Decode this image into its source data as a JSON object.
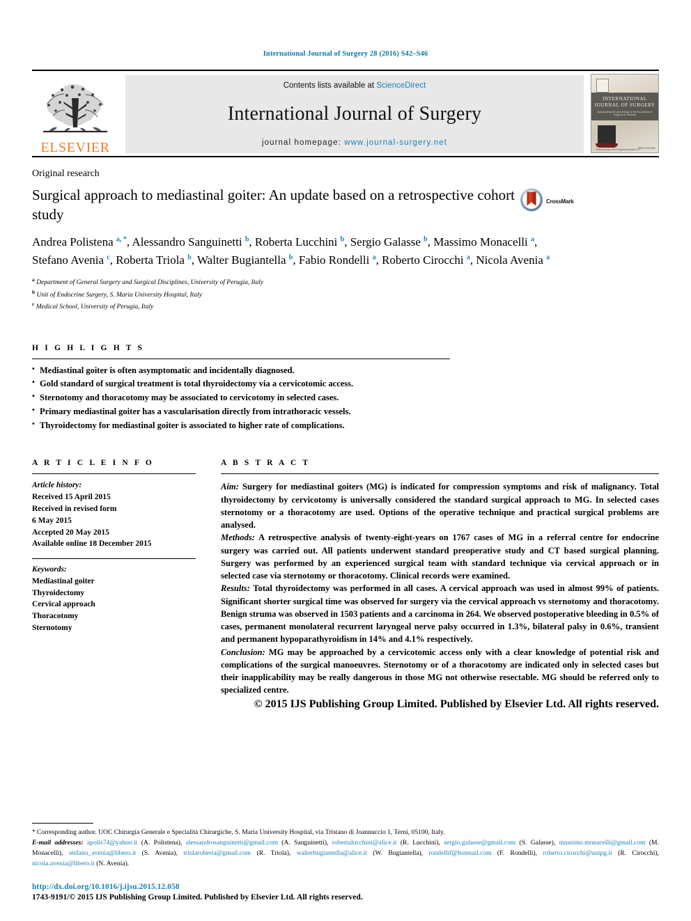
{
  "running_head": "International Journal of Surgery 28 (2016) S42–S46",
  "masthead": {
    "publisher": "ELSEVIER",
    "contents_prefix": "Contents lists available at ",
    "contents_link": "ScienceDirect",
    "journal_name": "International Journal of Surgery",
    "homepage_prefix": "journal homepage: ",
    "homepage_url": "www.journal-surgery.net",
    "cover": {
      "title_line1": "INTERNATIONAL",
      "title_line2": "JOURNAL OF SURGERY",
      "subtitle": "Incorporating the proceedings of the\nAssociation of Surgeons in Training",
      "foot_right": "ISSN 1743-9191",
      "foot_left": "Official journal of the Surgical Associates Ltd"
    }
  },
  "article": {
    "type": "Original research",
    "title": "Surgical approach to mediastinal goiter: An update based on a retrospective cohort study",
    "crossmark_label": "CrossMark",
    "authors": [
      {
        "name": "Andrea Polistena",
        "markers": "a, *",
        "sep": ", "
      },
      {
        "name": "Alessandro Sanguinetti",
        "markers": "b",
        "sep": ", "
      },
      {
        "name": "Roberta Lucchini",
        "markers": "b",
        "sep": ", "
      },
      {
        "name": "Sergio Galasse",
        "markers": "b",
        "sep": ", "
      },
      {
        "name": "Massimo Monacelli",
        "markers": "a",
        "sep": ", "
      },
      {
        "name": "Stefano Avenia",
        "markers": "c",
        "sep": ", "
      },
      {
        "name": "Roberta Triola",
        "markers": "b",
        "sep": ", "
      },
      {
        "name": "Walter Bugiantella",
        "markers": "b",
        "sep": ", "
      },
      {
        "name": "Fabio Rondelli",
        "markers": "a",
        "sep": ", "
      },
      {
        "name": "Roberto Cirocchi",
        "markers": "a",
        "sep": ", "
      },
      {
        "name": "Nicola Avenia",
        "markers": "a",
        "sep": ""
      }
    ],
    "affiliations": [
      {
        "marker": "a",
        "text": "Department of General Surgery and Surgical Disciplines, University of Perugia, Italy"
      },
      {
        "marker": "b",
        "text": "Unit of Endocrine Surgery, S. Maria University Hospital, Italy"
      },
      {
        "marker": "c",
        "text": "Medical School, University of Perugia, Italy"
      }
    ]
  },
  "highlights": {
    "heading": "H I G H L I G H T S",
    "items": [
      "Mediastinal goiter is often asymptomatic and incidentally diagnosed.",
      "Gold standard of surgical treatment is total thyroidectomy via a cervicotomic access.",
      "Sternotomy and thoracotomy may be associated to cervicotomy in selected cases.",
      "Primary mediastinal goiter has a vascularisation directly from intrathoracic vessels.",
      "Thyroidectomy for mediastinal goiter is associated to higher rate of complications."
    ]
  },
  "article_info": {
    "heading": "A R T I C L E   I N F O",
    "history_label": "Article history:",
    "history": [
      "Received 15 April 2015",
      "Received in revised form",
      "6 May 2015",
      "Accepted 20 May 2015",
      "Available online 18 December 2015"
    ],
    "keywords_label": "Keywords:",
    "keywords": [
      "Mediastinal goiter",
      "Thyroidectomy",
      "Cervical approach",
      "Thoracotomy",
      "Sternotomy"
    ]
  },
  "abstract": {
    "heading": "A B S T R A C T",
    "sections": [
      {
        "label": "Aim:",
        "text": " Surgery for mediastinal goiters (MG) is indicated for compression symptoms and risk of malignancy. Total thyroidectomy by cervicotomy is universally considered the standard surgical approach to MG. In selected cases sternotomy or a thoracotomy are used. Options of the operative technique and practical surgical problems are analysed."
      },
      {
        "label": "Methods:",
        "text": " A retrospective analysis of twenty-eight-years on 1767 cases of MG in a referral centre for endocrine surgery was carried out. All patients underwent standard preoperative study and CT based surgical planning. Surgery was performed by an experienced surgical team with standard technique via cervical approach or in selected case via sternotomy or thoracotomy. Clinical records were examined."
      },
      {
        "label": "Results:",
        "text": " Total thyroidectomy was performed in all cases. A cervical approach was used in almost 99% of patients. Significant shorter surgical time was observed for surgery via the cervical approach vs sternotomy and thoracotomy. Benign struma was observed in 1503 patients and a carcinoma in 264. We observed postoperative bleeding in 0.5% of cases, permanent monolateral recurrent laryngeal nerve palsy occurred in 1.3%, bilateral palsy in 0.6%, transient and permanent hypoparathyroidism in 14% and 4.1% respectively."
      },
      {
        "label": "Conclusion:",
        "text": " MG may be approached by a cervicotomic access only with a clear knowledge of potential risk and complications of the surgical manoeuvres. Sternotomy or of a thoracotomy are indicated only in selected cases but their inapplicability may be really dangerous in those MG not otherwise resectable. MG should be referred only to specialized centre."
      }
    ],
    "copyright": "© 2015 IJS Publishing Group Limited. Published by Elsevier Ltd. All rights reserved."
  },
  "footnotes": {
    "corresponding": "Corresponding author. UOC Chirurgia Generale e Specialità Chirurgiche, S. Maria University Hospital, via Tristano di Joannuccio 1, Terni, 05100, Italy.",
    "emails_label": "E-mail addresses:",
    "emails": [
      {
        "email": "apolis74@yahoo.it",
        "who": " (A. Polistena), "
      },
      {
        "email": "alessandrosanguinetti@gmail.com",
        "who": " (A. Sanguinetti), "
      },
      {
        "email": "robertalucchini@alice.it",
        "who": " (R. Lucchini), "
      },
      {
        "email": "sergio.galasse@gmail.com",
        "who": " (S. Galasse), "
      },
      {
        "email": "massimo.monacelli@gmail.com",
        "who": " (M. Monacelli), "
      },
      {
        "email": "stefano_avenia@libero.it",
        "who": " (S. Avenia), "
      },
      {
        "email": "triolaroberta@gmail.com",
        "who": " (R. Triola), "
      },
      {
        "email": "walterbugiantella@alice.it",
        "who": " (W. Bugiantella), "
      },
      {
        "email": "rondellif@hotmail.com",
        "who": " (F. Rondelli), "
      },
      {
        "email": "roberto.cirocchi@unipg.it",
        "who": " (R. Cirocchi), "
      },
      {
        "email": "nicola.avenia@libero.it",
        "who": " (N. Avenia)."
      }
    ]
  },
  "bottom": {
    "doi": "http://dx.doi.org/10.1016/j.ijsu.2015.12.058",
    "issn_line": "1743-9191/© 2015 IJS Publishing Group Limited. Published by Elsevier Ltd. All rights reserved."
  }
}
